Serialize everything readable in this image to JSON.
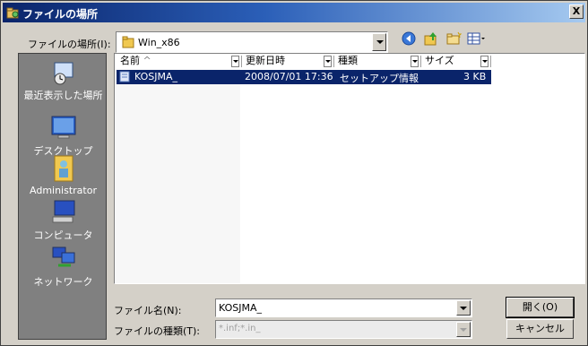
{
  "title_bar": {
    "title": "ファイルの場所",
    "close_glyph": "X"
  },
  "look_in": {
    "label": "ファイルの場所(I):",
    "value": "Win_x86"
  },
  "toolbar": {
    "icons": [
      "back-icon",
      "up-folder-icon",
      "new-folder-icon",
      "view-menu-icon"
    ]
  },
  "places": [
    {
      "label": "最近表示した場所",
      "icon": "recent-places-icon"
    },
    {
      "label": "デスクトップ",
      "icon": "desktop-icon"
    },
    {
      "label": "Administrator",
      "icon": "user-folder-icon"
    },
    {
      "label": "コンピュータ",
      "icon": "computer-icon"
    },
    {
      "label": "ネットワーク",
      "icon": "network-icon"
    }
  ],
  "file_list": {
    "columns": [
      "名前",
      "更新日時",
      "種類",
      "サイズ"
    ],
    "rows": [
      {
        "name": "KOSJMA_",
        "modified": "2008/07/01 17:36",
        "type": "セットアップ情報",
        "size": "3 KB"
      }
    ]
  },
  "filename": {
    "label": "ファイル名(N):",
    "value": "KOSJMA_"
  },
  "filetype": {
    "label": "ファイルの種類(T):",
    "value": "*.inf;*.in_"
  },
  "buttons": {
    "open": "開く(O)",
    "cancel": "キャンセル"
  },
  "colors": {
    "titlebar_start": "#0a246a",
    "titlebar_end": "#a6caf0",
    "selection": "#0a246a",
    "places_bg": "#808080"
  }
}
